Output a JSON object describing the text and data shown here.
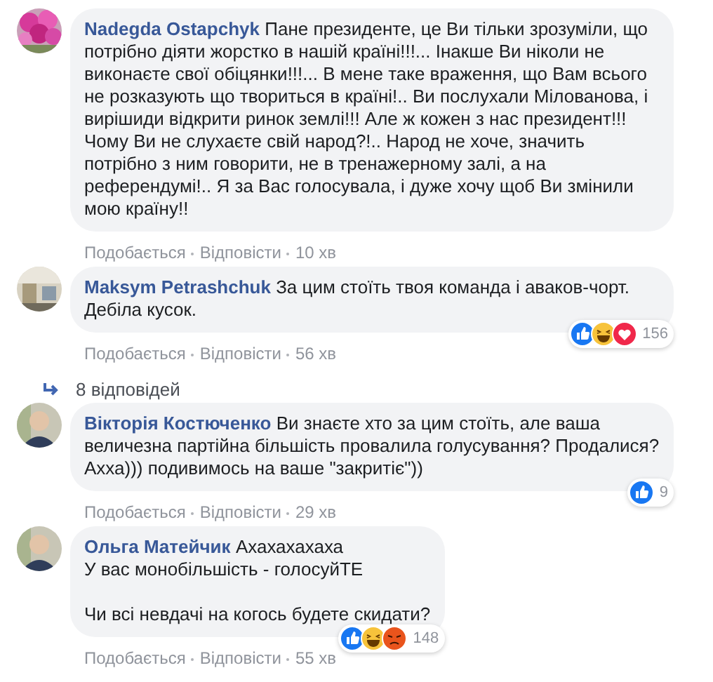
{
  "comments": [
    {
      "author": "Nadegda Ostapchyk",
      "paragraphs": [
        "Пане президенте, це Ви тільки зрозуміли, що потрібно діяти жорстко в нашій країні!!!... Інакше Ви ніколи не виконаєте свої обіцянки!!!... В мене таке враження, що Вам всього не розказують що твориться в країні!.. Ви послухали Мілованова, і вирішиди відкрити ринок землі!!! Але ж кожен з нас президент!!! Чому Ви не слухаєте свій народ?!.. Народ не хоче, значить потрібно з ним говорити, не в тренажерному залі, а на референдумі!.. Я за Вас голосувала, і дуже хочу щоб Ви змінили мою країну!!"
      ],
      "actions": [
        "Подобається",
        "Відповісти"
      ],
      "time": "10 хв"
    },
    {
      "author": "Maksym Petrashchuk",
      "paragraphs": [
        "За цим стоїть твоя команда і аваков-чорт. Дебіла кусок."
      ],
      "actions": [
        "Подобається",
        "Відповісти"
      ],
      "time": "56 хв",
      "reactions": [
        {
          "kind": "like"
        },
        {
          "kind": "haha"
        },
        {
          "kind": "love"
        }
      ],
      "reaction_count": "156",
      "replies": "8 відповідей"
    },
    {
      "author": "Вікторія Костюченко",
      "paragraphs": [
        "Ви знаєте хто за цим стоїть, але ваша величезна партійна більшість провалила голусування? Продалися? Ахха))) подивимось на ваше \"закритіє\"))"
      ],
      "actions": [
        "Подобається",
        "Відповісти"
      ],
      "time": "29 хв",
      "reactions": [
        {
          "kind": "like"
        }
      ],
      "reaction_count": "9"
    },
    {
      "author": "Ольга Матейчик",
      "paragraphs": [
        "Ахахахахаха\nУ вас монобільшість - голосуйТЕ",
        "Чи всі невдачі на когось будете скидати?"
      ],
      "actions": [
        "Подобається",
        "Відповісти"
      ],
      "time": "55 хв",
      "reactions": [
        {
          "kind": "like"
        },
        {
          "kind": "haha"
        },
        {
          "kind": "angry"
        }
      ],
      "reaction_count": "148"
    }
  ]
}
